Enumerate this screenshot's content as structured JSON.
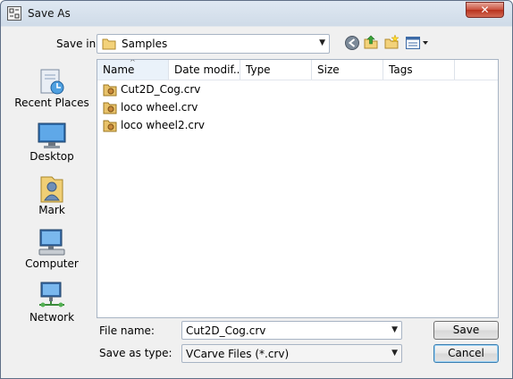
{
  "window": {
    "title": "Save As",
    "close_glyph": "✕"
  },
  "toolbar": {
    "save_in_label": "Save in:",
    "location_value": "Samples",
    "icons": [
      "back-icon",
      "up-folder-icon",
      "new-folder-icon",
      "views-menu-icon"
    ]
  },
  "places": [
    {
      "label": "Recent Places",
      "icon": "recent-places-icon"
    },
    {
      "label": "Desktop",
      "icon": "desktop-icon"
    },
    {
      "label": "Mark",
      "icon": "user-folder-icon"
    },
    {
      "label": "Computer",
      "icon": "computer-icon"
    },
    {
      "label": "Network",
      "icon": "network-icon"
    }
  ],
  "columns": [
    "Name",
    "Date modif...",
    "Type",
    "Size",
    "Tags"
  ],
  "files": [
    {
      "name": "Cut2D_Cog.crv"
    },
    {
      "name": "loco wheel.crv"
    },
    {
      "name": "loco wheel2.crv"
    }
  ],
  "form": {
    "file_name_label": "File name:",
    "file_name_value": "Cut2D_Cog.crv",
    "save_type_label": "Save as type:",
    "save_type_value": "VCarve Files (*.crv)"
  },
  "buttons": {
    "save": "Save",
    "cancel": "Cancel"
  }
}
